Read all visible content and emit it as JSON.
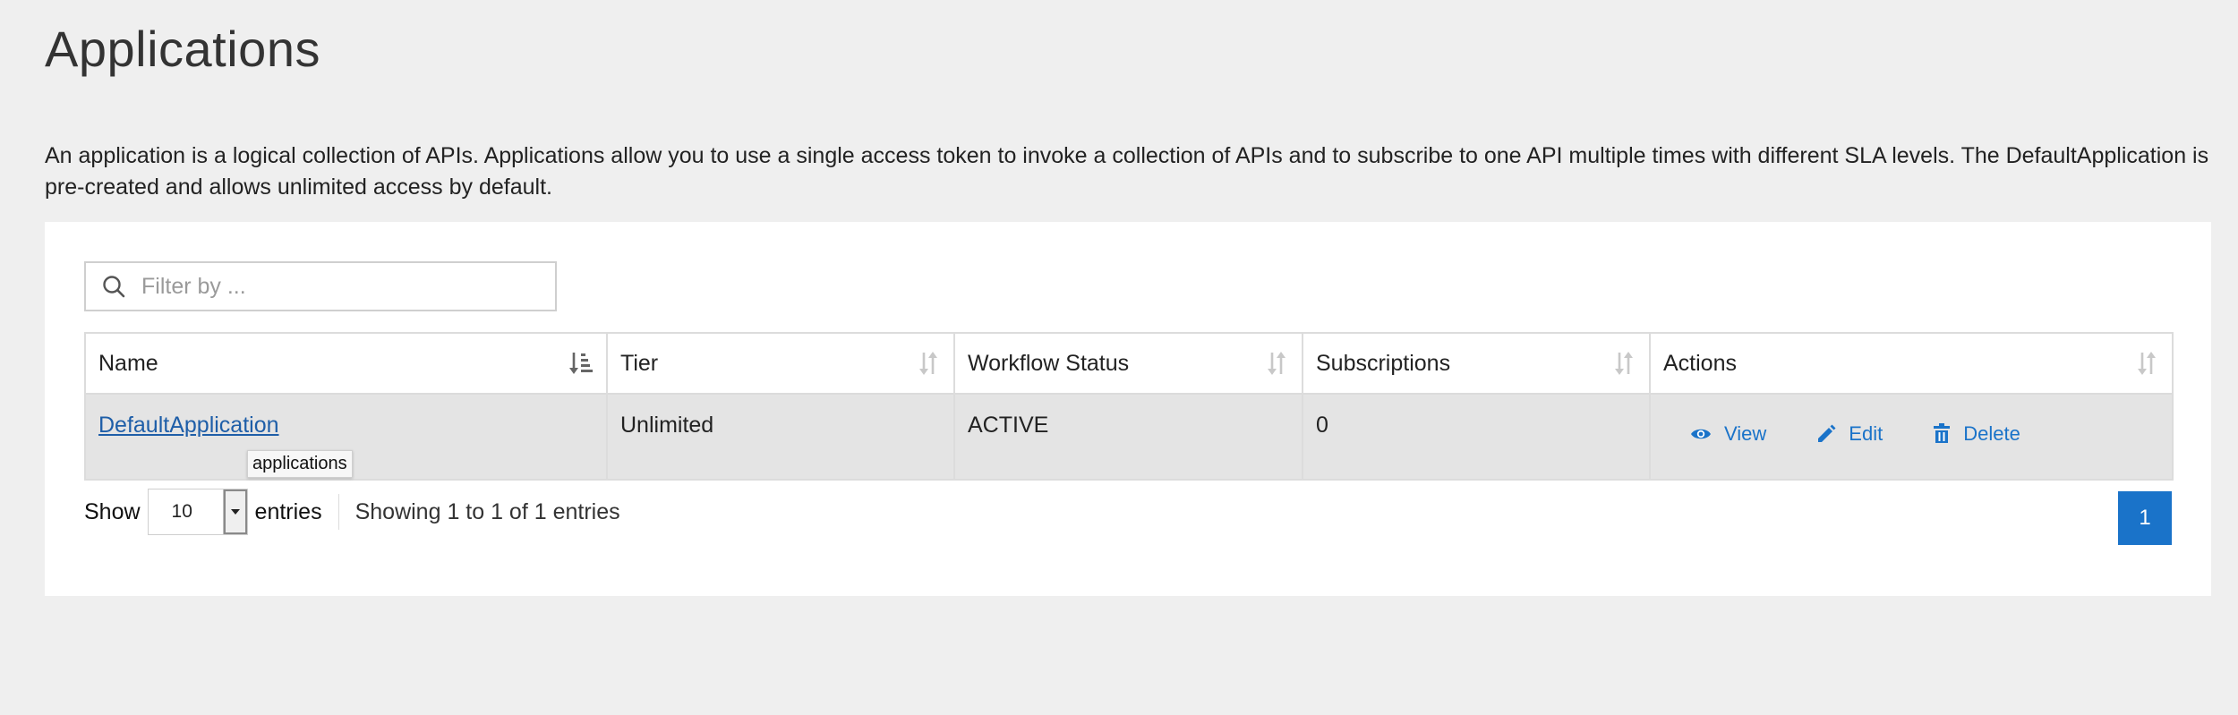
{
  "page": {
    "title": "Applications",
    "description": "An application is a logical collection of APIs. Applications allow you to use a single access token to invoke a collection of APIs and to subscribe to one API multiple times with different SLA levels. The DefaultApplication is pre-created and allows unlimited access by default."
  },
  "filter": {
    "placeholder": "Filter by ..."
  },
  "table": {
    "columns": [
      "Name",
      "Tier",
      "Workflow Status",
      "Subscriptions",
      "Actions"
    ],
    "rows": [
      {
        "name": "DefaultApplication",
        "tier": "Unlimited",
        "workflow_status": "ACTIVE",
        "subscriptions": "0"
      }
    ],
    "actions": {
      "view": "View",
      "edit": "Edit",
      "delete": "Delete"
    },
    "tooltip": "applications"
  },
  "footer": {
    "show_label": "Show",
    "page_length": "10",
    "entries_label": "entries",
    "info": "Showing 1 to 1 of 1 entries",
    "current_page": "1"
  },
  "colors": {
    "accent": "#1a73c9",
    "link": "#1e5ea8",
    "background": "#efefef"
  }
}
